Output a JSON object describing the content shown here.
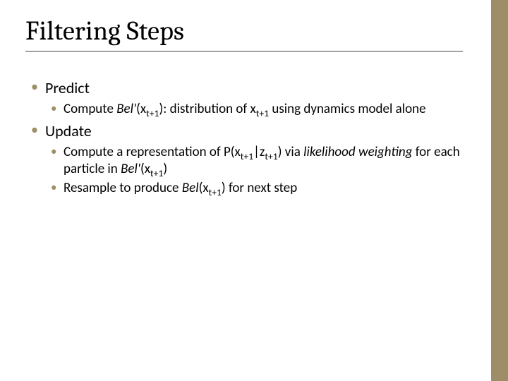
{
  "title": "Filtering Steps",
  "bullets": {
    "predict": {
      "label": "Predict",
      "sub1_a": "Compute ",
      "sub1_b": "Bel'",
      "sub1_c": "(x",
      "sub1_d": "t+1",
      "sub1_e": "): distribution of x",
      "sub1_f": "t+1",
      "sub1_g": " using dynamics model alone"
    },
    "update": {
      "label": "Update",
      "sub1_a": "Compute a representation of P(x",
      "sub1_b": "t+1",
      "sub1_c": "|z",
      "sub1_d": "t+1",
      "sub1_e": ") via ",
      "sub1_f": "likelihood weighting",
      "sub1_g": " for each particle in ",
      "sub1_h": "Bel'",
      "sub1_i": "(x",
      "sub1_j": "t+1",
      "sub1_k": ")",
      "sub2_a": "Resample to produce ",
      "sub2_b": "Bel",
      "sub2_c": "(x",
      "sub2_d": "t+1",
      "sub2_e": ") for next step"
    }
  }
}
